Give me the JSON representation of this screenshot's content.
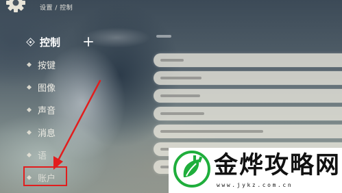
{
  "header": {
    "breadcrumb": "设置 / 控制",
    "settings_icon": "gear-icon"
  },
  "sidebar": {
    "items": [
      {
        "label": "控制",
        "state": "active"
      },
      {
        "label": "按键",
        "state": "normal"
      },
      {
        "label": "图像",
        "state": "normal"
      },
      {
        "label": "声音",
        "state": "normal"
      },
      {
        "label": "消息",
        "state": "normal"
      },
      {
        "label": "语",
        "state": "partially-hidden"
      },
      {
        "label": "账户",
        "state": "highlighted"
      }
    ]
  },
  "annotation": {
    "color": "#e21d1d",
    "target": "账户"
  },
  "watermark": {
    "title": "金烨攻略网",
    "url": "www.jykz.com.cn",
    "logo_color": "#1fae3c"
  }
}
